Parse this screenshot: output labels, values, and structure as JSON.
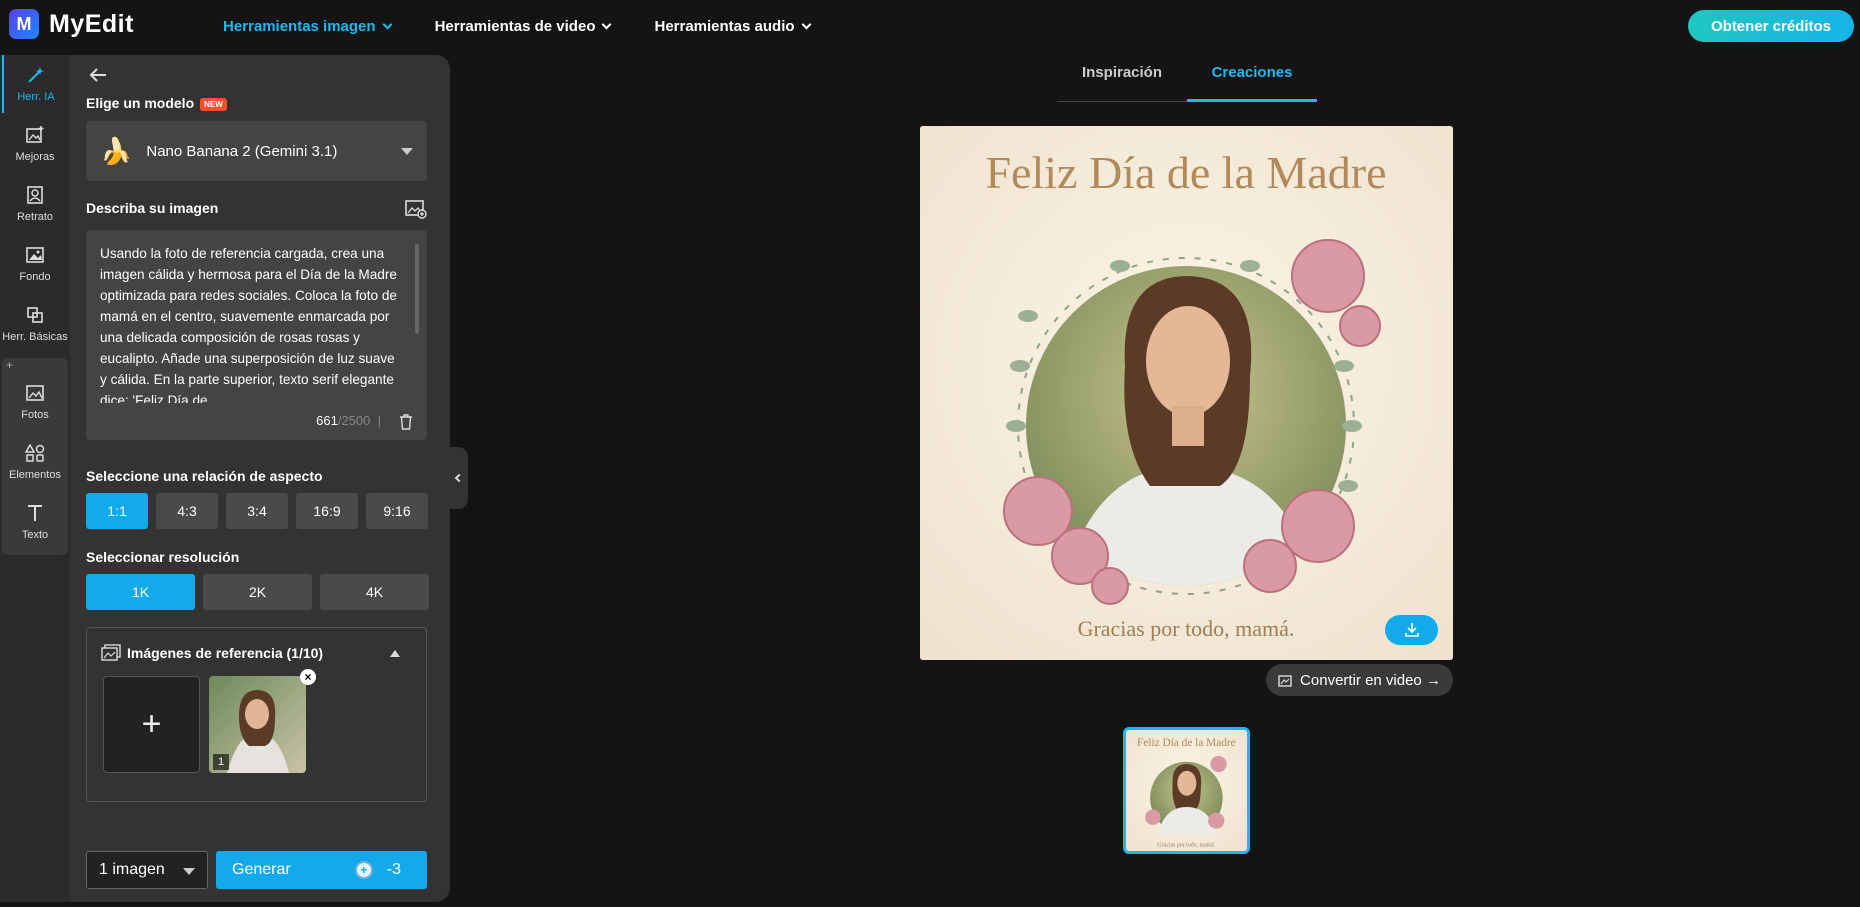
{
  "app": {
    "logo_text": "MyEdit",
    "logo_letter": "M"
  },
  "topnav": [
    {
      "label": "Herramientas imagen",
      "active": true
    },
    {
      "label": "Herramientas de video",
      "active": false
    },
    {
      "label": "Herramientas audio",
      "active": false
    }
  ],
  "credits_button": "Obtener créditos",
  "rail": [
    {
      "label": "Herr. IA",
      "icon": "magic-wand-icon",
      "active": true
    },
    {
      "label": "Mejoras",
      "icon": "image-enhance-icon"
    },
    {
      "label": "Retrato",
      "icon": "portrait-icon"
    },
    {
      "label": "Fondo",
      "icon": "background-icon"
    },
    {
      "label": "Herr. Básicas",
      "icon": "basic-tools-icon"
    },
    {
      "label": "Fotos",
      "icon": "photo-icon"
    },
    {
      "label": "Elementos",
      "icon": "shapes-icon"
    },
    {
      "label": "Texto",
      "icon": "text-icon"
    }
  ],
  "rail_plus": "+",
  "panel": {
    "model_title": "Elige un modelo",
    "new_badge": "NEW",
    "model_name": "Nano Banana 2 (Gemini 3.1)",
    "model_emoji": "🍌",
    "describe_title": "Describa su imagen",
    "prompt": "Usando la foto de referencia cargada, crea una imagen cálida y hermosa para el Día de la Madre optimizada para redes sociales. Coloca la foto de mamá en el centro, suavemente enmarcada por una delicada composición de rosas rosas y eucalipto. Añade una superposición de luz suave y cálida. En la parte superior, texto serif elegante dice: 'Feliz Día de",
    "char_count": "661",
    "char_max": "/2500",
    "char_sep": "|",
    "aspect_title": "Seleccione una relación de aspecto",
    "aspect_options": [
      "1:1",
      "4:3",
      "3:4",
      "16:9",
      "9:16"
    ],
    "aspect_selected": "1:1",
    "resolution_title": "Seleccionar resolución",
    "resolution_options": [
      "1K",
      "2K",
      "4K"
    ],
    "resolution_selected": "1K",
    "ref_title": "Imágenes de referencia (1/10)",
    "ref_add": "+",
    "ref_close": "×",
    "ref_number": "1",
    "count_value": "1 imagen",
    "generate_label": "Generar",
    "generate_cost": "-3",
    "cost_icon": "+"
  },
  "tabs": [
    {
      "label": "Inspiración",
      "active": false
    },
    {
      "label": "Creaciones",
      "active": true
    }
  ],
  "result": {
    "title_text": "Feliz Día de la Madre",
    "footer_text": "Gracias por todo, mamá."
  },
  "convert_video": "Convertir en video →",
  "colors": {
    "accent": "#12aaeb",
    "rose": "#d99aa3",
    "gold": "#b08a5a"
  }
}
